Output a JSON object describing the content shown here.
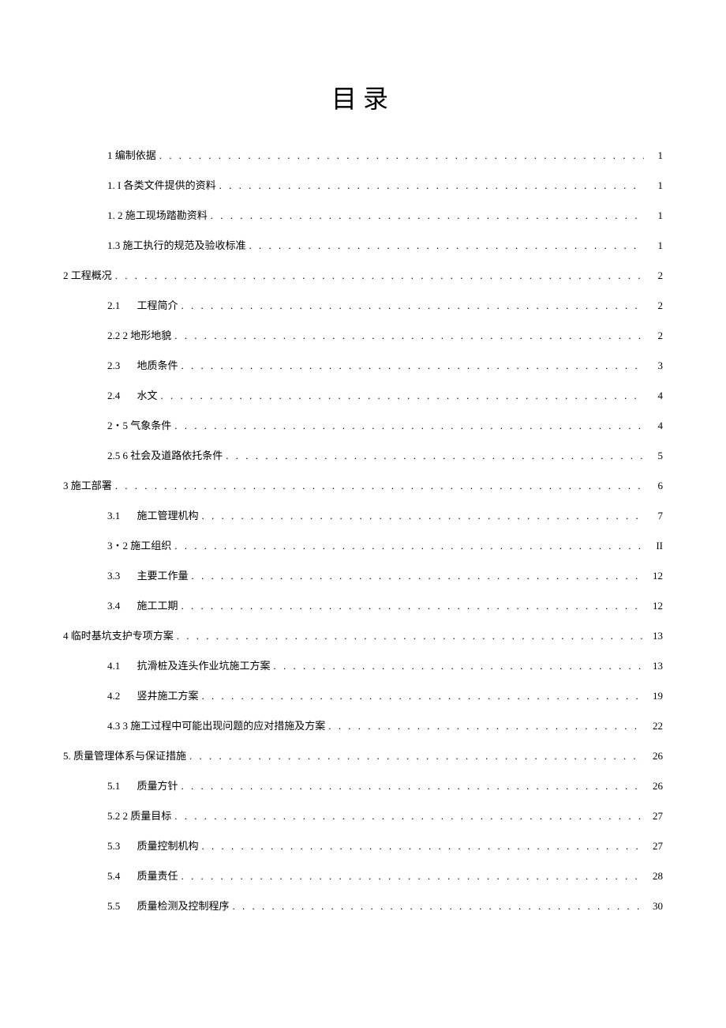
{
  "title": "目录",
  "entries": [
    {
      "level": 2,
      "num": "1",
      "text": "编制依据",
      "page": "1",
      "gap": false
    },
    {
      "level": 2,
      "num": "1. I",
      "text": "各类文件提供的资料",
      "page": "1",
      "gap": false
    },
    {
      "level": 2,
      "num": "1. 2",
      "text": "施工现场踏勘资料",
      "page": "1",
      "gap": false
    },
    {
      "level": 2,
      "num": "1.3",
      "text": "施工执行的规范及验收标准",
      "page": "1",
      "gap": false
    },
    {
      "level": 1,
      "num": "2",
      "text": "工程概况",
      "page": "2",
      "gap": false
    },
    {
      "level": 2,
      "num": "2.1",
      "text": "工程简介",
      "page": "2",
      "gap": true
    },
    {
      "level": 2,
      "num": "2.2  2",
      "text": "地形地貌",
      "page": "2",
      "gap": false
    },
    {
      "level": 2,
      "num": "2.3",
      "text": "地质条件",
      "page": "3",
      "gap": true
    },
    {
      "level": 2,
      "num": "2.4",
      "text": "水文",
      "page": "4",
      "gap": true
    },
    {
      "level": 2,
      "num": "2・5",
      "text": "气象条件",
      "page": "4",
      "gap": false
    },
    {
      "level": 2,
      "num": "2.5  6",
      "text": "社会及道路依托条件",
      "page": "5",
      "gap": false
    },
    {
      "level": 1,
      "num": "3",
      "text": "施工部署",
      "page": "6",
      "gap": false
    },
    {
      "level": 2,
      "num": "3.1",
      "text": "施工管理机构",
      "page": "7",
      "gap": true
    },
    {
      "level": 2,
      "num": "3・2",
      "text": "施工组织",
      "page": "II",
      "gap": false
    },
    {
      "level": 2,
      "num": "3.3",
      "text": "主要工作量",
      "page": "12",
      "gap": true
    },
    {
      "level": 2,
      "num": "3.4",
      "text": "施工工期",
      "page": "12",
      "gap": true
    },
    {
      "level": 1,
      "num": "4",
      "text": "临时基坑支护专项方案",
      "page": "13",
      "gap": false
    },
    {
      "level": 2,
      "num": "4.1",
      "text": "抗滑桩及连头作业坑施工方案",
      "page": "13",
      "gap": true
    },
    {
      "level": 2,
      "num": "4.2",
      "text": "竖井施工方案",
      "page": "19",
      "gap": true
    },
    {
      "level": 2,
      "num": "4.3  3",
      "text": "施工过程中可能出现问题的应对措施及方案",
      "page": "22",
      "gap": false
    },
    {
      "level": 1,
      "num": "5.",
      "text": "质量管理体系与保证措施",
      "page": "26",
      "gap": false
    },
    {
      "level": 2,
      "num": "5.1",
      "text": "质量方针",
      "page": "26",
      "gap": true
    },
    {
      "level": 2,
      "num": "5.2  2",
      "text": "质量目标",
      "page": "27",
      "gap": false
    },
    {
      "level": 2,
      "num": "5.3",
      "text": "质量控制机构",
      "page": "27",
      "gap": true
    },
    {
      "level": 2,
      "num": "5.4",
      "text": "质量责任",
      "page": "28",
      "gap": true
    },
    {
      "level": 2,
      "num": "5.5",
      "text": "质量检测及控制程序",
      "page": "30",
      "gap": true
    }
  ]
}
